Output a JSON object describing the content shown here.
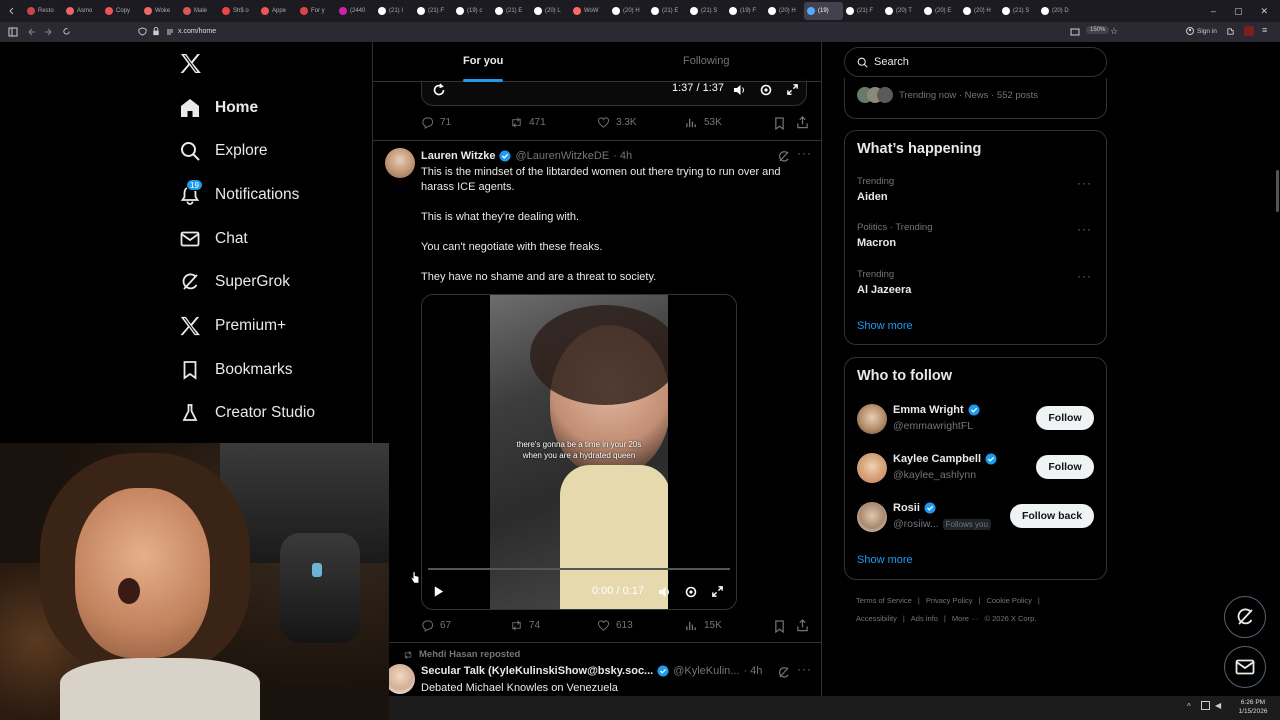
{
  "browser": {
    "tabs": [
      "Resto",
      "Asmo",
      "Copy",
      "Woke",
      "Male",
      "Sh$ o",
      "Appe",
      "For y",
      "(2440",
      "(21) I",
      "(21) F",
      "(19) c",
      "(21) E",
      "(20) L",
      "WoW",
      "(20) H",
      "(21) E",
      "(21) S",
      "(19) F",
      "(20) H",
      "(19)",
      "(21) F",
      "(20) T",
      "(20) E",
      "(20) H",
      "(21) S",
      "(20) D"
    ],
    "url": "x.com/home",
    "zoom": "150%",
    "sign_in": "Sign in"
  },
  "nav": {
    "items": [
      {
        "label": "Home",
        "icon": "home-icon"
      },
      {
        "label": "Explore",
        "icon": "search-icon"
      },
      {
        "label": "Notifications",
        "icon": "bell-icon"
      },
      {
        "label": "Chat",
        "icon": "mail-icon"
      },
      {
        "label": "SuperGrok",
        "icon": "grok-icon"
      },
      {
        "label": "Premium+",
        "icon": "x-logo-icon"
      },
      {
        "label": "Bookmarks",
        "icon": "bookmark-icon"
      },
      {
        "label": "Creator Studio",
        "icon": "flask-icon"
      }
    ],
    "notifications_badge": "19"
  },
  "feed": {
    "tabs": {
      "for_you": "For you",
      "following": "Following"
    },
    "prev_video": {
      "time": "1:37 / 1:37"
    },
    "prev_metrics": {
      "replies": "71",
      "reposts": "471",
      "likes": "3.3K",
      "views": "53K"
    },
    "tweet": {
      "name": "Lauren Witzke",
      "handle": "@LaurenWitzkeDE",
      "time": "· 4h",
      "text1": "This is the mindset of the libtarded women out there trying to run over and",
      "text2": "harass ICE agents.",
      "text3": "This is what they're dealing with.",
      "text4": "You can't negotiate with these freaks.",
      "text5": "They have no shame and are a threat to society.",
      "video_caption1": "there's gonna be a time in your 20s",
      "video_caption2": "when you are a hydrated queen",
      "video_time": "0:00 / 0:17",
      "metrics": {
        "replies": "67",
        "reposts": "74",
        "likes": "613",
        "views": "15K"
      }
    },
    "next": {
      "reposted_by": "Mehdi Hasan reposted",
      "name": "Secular Talk (KyleKulinskiShow@bsky.soc...",
      "handle": "@KyleKulin...",
      "time": "· 4h",
      "text": "Debated Michael Knowles on Venezuela"
    }
  },
  "sidebar": {
    "search_placeholder": "Search",
    "trending_now": "Trending now · News · 552 posts",
    "whats_happening": {
      "title": "What’s happening",
      "trends": [
        {
          "meta": "Trending",
          "name": "Aiden"
        },
        {
          "meta": "Politics · Trending",
          "name": "Macron"
        },
        {
          "meta": "Trending",
          "name": "Al Jazeera"
        }
      ],
      "show_more": "Show more"
    },
    "who_to_follow": {
      "title": "Who to follow",
      "users": [
        {
          "name": "Emma Wright",
          "handle": "@emmawrightFL",
          "button": "Follow"
        },
        {
          "name": "Kaylee Campbell",
          "handle": "@kaylee_ashlynn",
          "button": "Follow"
        },
        {
          "name": "Rosii",
          "handle": "@rosiiw...",
          "badge": "Follows you",
          "button": "Follow back"
        }
      ],
      "show_more": "Show more"
    },
    "footer": {
      "line1": [
        "Terms of Service",
        "|",
        "Privacy Policy",
        "|",
        "Cookie Policy",
        "|"
      ],
      "line2": [
        "Accessibility",
        "|",
        "Ads info",
        "|",
        "More ···",
        "© 2026 X Corp."
      ]
    }
  },
  "taskbar": {
    "time": "6:26 PM",
    "date": "1/15/2026"
  },
  "colors": {
    "accent": "#1d9bf0",
    "background": "#000000",
    "border": "#2f3336",
    "muted": "#71767b"
  }
}
